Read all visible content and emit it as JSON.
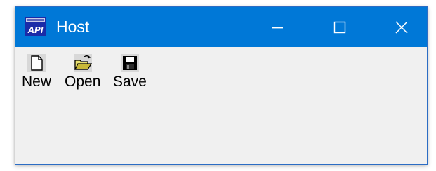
{
  "window": {
    "title": "Host",
    "accent_color": "#0078d7",
    "app_icon": "api-icon",
    "app_icon_text": "API",
    "caption_buttons": {
      "minimize_icon": "minimize-icon",
      "maximize_icon": "maximize-icon",
      "close_icon": "close-icon"
    }
  },
  "toolbar": {
    "items": [
      {
        "label": "New",
        "icon": "new-document-icon"
      },
      {
        "label": "Open",
        "icon": "open-folder-icon"
      },
      {
        "label": "Save",
        "icon": "floppy-disk-icon"
      }
    ]
  }
}
